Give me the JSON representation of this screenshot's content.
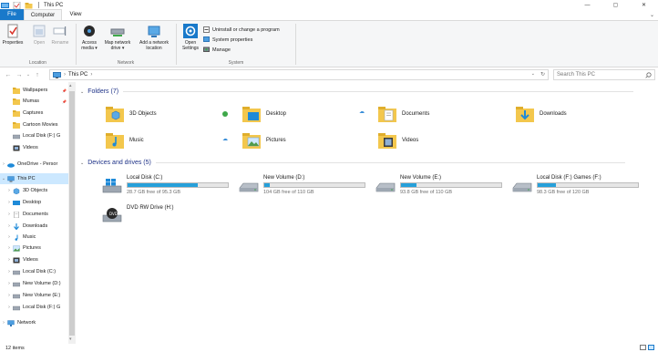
{
  "window": {
    "title": "This PC",
    "controls": [
      "—",
      "▢",
      "✕"
    ]
  },
  "ribbon": {
    "tabs": [
      "File",
      "Computer",
      "View"
    ],
    "location_group": {
      "label": "Location",
      "buttons": [
        "Properties",
        "Open",
        "Rename"
      ]
    },
    "network_group": {
      "label": "Network",
      "buttons": [
        {
          "line1": "Access",
          "line2": "media ▾"
        },
        {
          "line1": "Map network",
          "line2": "drive ▾"
        },
        {
          "line1": "Add a network",
          "line2": "location"
        }
      ]
    },
    "system_group": {
      "label": "System",
      "open_settings": {
        "line1": "Open",
        "line2": "Settings"
      },
      "items": [
        "Uninstall or change a program",
        "System properties",
        "Manage"
      ]
    }
  },
  "address": {
    "path": "This PC",
    "search_placeholder": "Search This PC"
  },
  "nav": {
    "items": [
      {
        "label": "Wallpapers",
        "icon": "folder-yellow-icon",
        "pinned": true
      },
      {
        "label": "Mumas",
        "icon": "folder-yellow-icon",
        "pinned": true
      },
      {
        "label": "Captures",
        "icon": "folder-yellow-icon",
        "pinned": false
      },
      {
        "label": "Cartoon Movies",
        "icon": "folder-yellow-icon",
        "pinned": false
      },
      {
        "label": "Local Disk (F:) G",
        "icon": "drive-icon",
        "pinned": false
      },
      {
        "label": "Videos",
        "icon": "videos-icon",
        "pinned": false
      },
      {
        "label": "OneDrive - Persor",
        "icon": "onedrive-icon",
        "pinned": false
      },
      {
        "label": "This PC",
        "icon": "this-pc-icon",
        "pinned": false
      },
      {
        "label": "3D Objects",
        "icon": "3d-objects-icon",
        "pinned": false
      },
      {
        "label": "Desktop",
        "icon": "desktop-icon",
        "pinned": false
      },
      {
        "label": "Documents",
        "icon": "documents-icon",
        "pinned": false
      },
      {
        "label": "Downloads",
        "icon": "downloads-icon",
        "pinned": false
      },
      {
        "label": "Music",
        "icon": "music-icon",
        "pinned": false
      },
      {
        "label": "Pictures",
        "icon": "pictures-icon",
        "pinned": false
      },
      {
        "label": "Videos",
        "icon": "videos-icon",
        "pinned": false
      },
      {
        "label": "Local Disk (C:)",
        "icon": "drive-icon",
        "pinned": false
      },
      {
        "label": "New Volume (D:)",
        "icon": "drive-icon",
        "pinned": false
      },
      {
        "label": "New Volume (E:)",
        "icon": "drive-icon",
        "pinned": false
      },
      {
        "label": "Local Disk (F:) G",
        "icon": "drive-icon",
        "pinned": false
      },
      {
        "label": "Network",
        "icon": "network-icon",
        "pinned": false
      }
    ]
  },
  "folders": {
    "header": "Folders (7)",
    "items": [
      {
        "label": "3D Objects",
        "status": ""
      },
      {
        "label": "Desktop",
        "status": "synced"
      },
      {
        "label": "Documents",
        "status": "cloud"
      },
      {
        "label": "Downloads",
        "status": ""
      },
      {
        "label": "Music",
        "status": ""
      },
      {
        "label": "Pictures",
        "status": "cloud"
      },
      {
        "label": "Videos",
        "status": ""
      }
    ]
  },
  "drives": {
    "header": "Devices and drives (5)",
    "items": [
      {
        "name": "Local Disk (C:)",
        "free": "28.7 GB free of 95.3 GB",
        "used_fraction": 0.7
      },
      {
        "name": "New Volume (D:)",
        "free": "104 GB free of 110 GB",
        "used_fraction": 0.05
      },
      {
        "name": "New Volume (E:)",
        "free": "93.8 GB free of 110 GB",
        "used_fraction": 0.15
      },
      {
        "name": "Local Disk (F:) Games (F:)",
        "free": "98.3 GB free of 120 GB",
        "used_fraction": 0.18
      },
      {
        "name": "DVD RW Drive (H:)",
        "free": "",
        "used_fraction": null
      }
    ]
  },
  "status": {
    "items_count": "12 items"
  },
  "colors": {
    "accent": "#1979ca",
    "selection": "#cce8ff",
    "drive_bar": "#26a0da",
    "section_header": "#1e3287"
  }
}
